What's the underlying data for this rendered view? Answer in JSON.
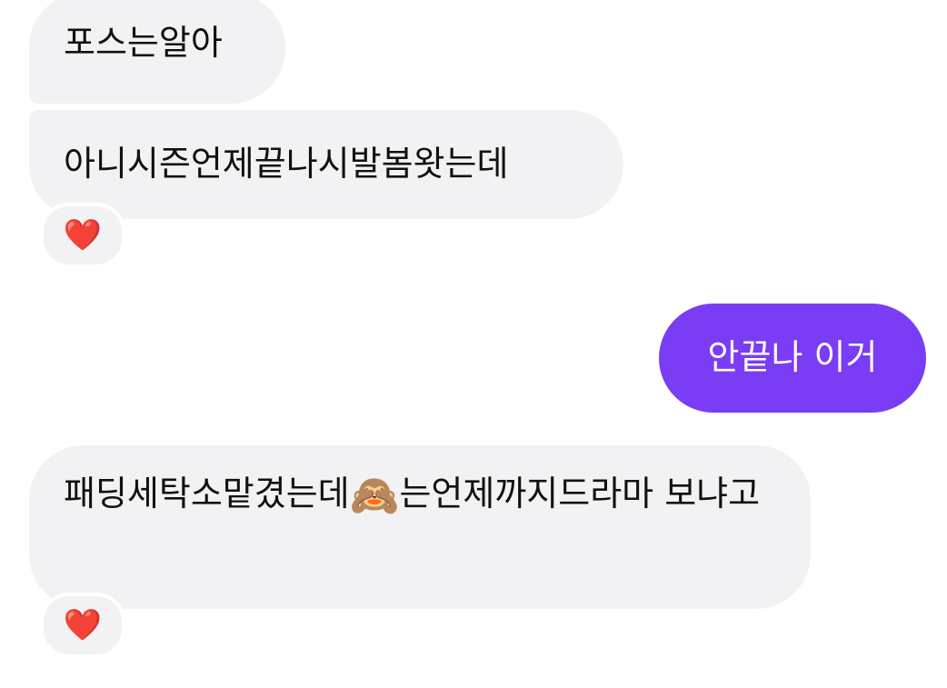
{
  "messages": [
    {
      "id": "m1",
      "direction": "incoming",
      "text": "포스는알아"
    },
    {
      "id": "m2",
      "direction": "incoming",
      "text": "아니시즌언제끝나시발봄왓는데",
      "reaction": "❤️"
    },
    {
      "id": "m3",
      "direction": "outgoing",
      "text": "안끝나 이거"
    },
    {
      "id": "m4",
      "direction": "incoming",
      "text_before_emoji": "패딩세탁소맡겼는데",
      "emoji": "🙈",
      "text_after_emoji": "는언제까지드라마 보냐고",
      "reaction": "❤️"
    }
  ],
  "colors": {
    "incoming_bubble": "#f2f2f4",
    "outgoing_bubble": "#7a3cf5",
    "reaction_heart": "#e0202a"
  },
  "icons": {
    "reaction": "heart-icon",
    "inline_emoji": "see-no-evil-monkey-icon"
  }
}
